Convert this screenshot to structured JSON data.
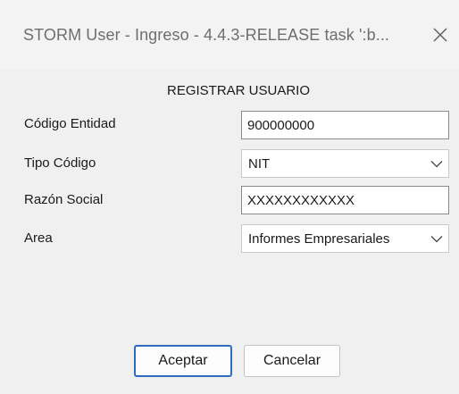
{
  "window": {
    "title": "STORM User - Ingreso - 4.4.3-RELEASE  task ':b...",
    "close_icon": "close-icon"
  },
  "form": {
    "heading": "REGISTRAR USUARIO",
    "codigo_entidad": {
      "label": "Código Entidad",
      "value": "900000000"
    },
    "tipo_codigo": {
      "label": "Tipo Código",
      "selected": "NIT"
    },
    "razon_social": {
      "label": "Razón Social",
      "value": "XXXXXXXXXXXX"
    },
    "area": {
      "label": "Area",
      "selected": "Informes Empresariales"
    }
  },
  "buttons": {
    "accept": "Aceptar",
    "cancel": "Cancelar"
  },
  "colors": {
    "primary_border": "#2b6cc4",
    "window_bg": "#f0f0f0"
  }
}
